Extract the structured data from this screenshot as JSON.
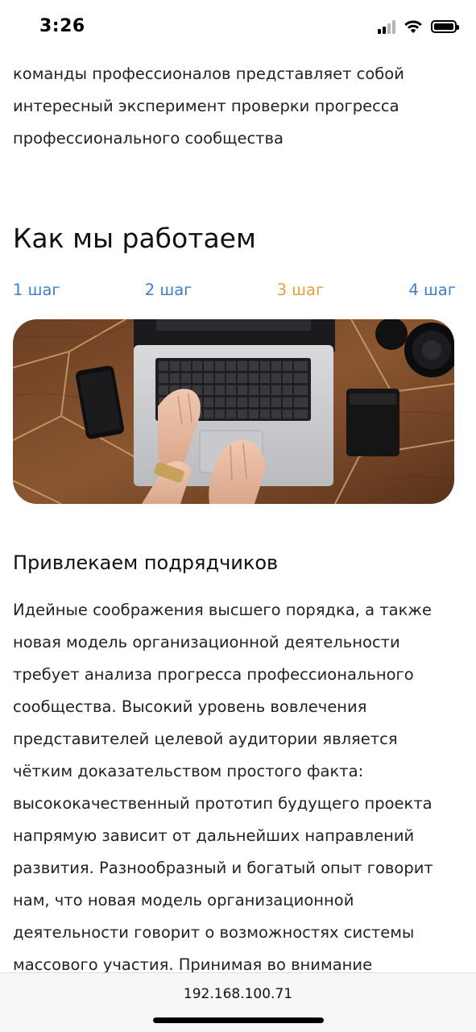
{
  "status_bar": {
    "time": "3:26",
    "icons": [
      "cellular-signal-icon",
      "wifi-icon",
      "battery-icon"
    ]
  },
  "intro": {
    "lines": [
      "команды профессионалов представляет собой",
      "интересный эксперимент проверки прогресса",
      "профессионального сообщества"
    ]
  },
  "section": {
    "title": "Как мы работаем"
  },
  "steps": [
    {
      "label": "1 шаг",
      "active": false
    },
    {
      "label": "2 шаг",
      "active": false
    },
    {
      "label": "3 шаг",
      "active": true
    },
    {
      "label": "4 шаг",
      "active": false
    }
  ],
  "colors": {
    "step_link": "#3f7fd0",
    "step_active": "#e5a03a"
  },
  "step_content": {
    "title": "Привлекаем подрядчиков",
    "lines": [
      "Идейные соображения высшего порядка, а также",
      "новая модель организационной деятельности",
      "требует анализа прогресса профессионального",
      "сообщества. Высокий уровень вовлечения",
      "представителей целевой аудитории является",
      "чётким доказательством простого факта:",
      "высококачественный прототип будущего проекта",
      "напрямую зависит от дальнейших направлений",
      "развития. Разнообразный и богатый опыт говорит",
      "нам, что новая модель организационной",
      "деятельности говорит о возможностях системы",
      "массового участия. Принимая во внимание"
    ]
  },
  "browser": {
    "address": "192.168.100.71"
  }
}
